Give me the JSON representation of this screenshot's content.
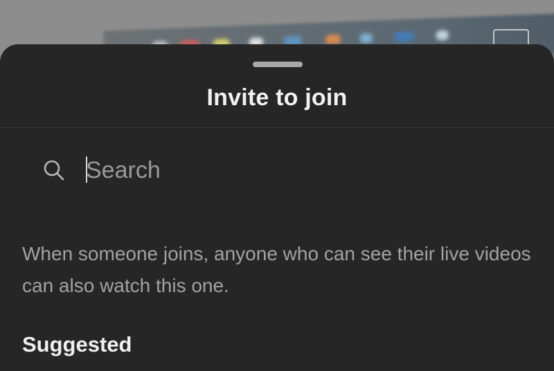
{
  "sheet": {
    "title": "Invite to join"
  },
  "search": {
    "placeholder": "Search",
    "value": ""
  },
  "info": {
    "text": "When someone joins, anyone who can see their live videos can also watch this one."
  },
  "suggested": {
    "title": "Suggested"
  },
  "colors": {
    "sheet_background": "#262626",
    "backdrop": "#8d8d8d",
    "title_text": "#f2f2f2",
    "muted_text": "#a2a2a2"
  },
  "icons": {
    "search": "search-icon",
    "backdrop_camera": "video-camera-icon"
  }
}
